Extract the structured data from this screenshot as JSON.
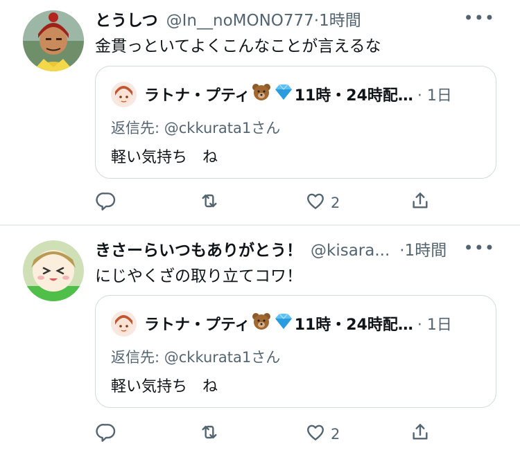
{
  "tweets": [
    {
      "name": "とうしつ",
      "handle": "@In__noMONO777",
      "time": "·1時間",
      "text": "金貫っといてよくこんなことが言えるな",
      "more": "•••",
      "quote": {
        "name": "ラトナ・プティ",
        "name_suffix": "11時・24時配…",
        "time": "· 1日",
        "reply_to": "返信先: @ckkurata1さん",
        "text": "軽い気持ち　ね"
      },
      "actions": {
        "reply": "",
        "retweet": "",
        "like_count": "2",
        "share": ""
      }
    },
    {
      "name": "きさーらいつもありがとう！",
      "handle": "@kisara...",
      "time": "·1時間",
      "text": "にじやくざの取り立てコワ！",
      "more": "•••",
      "quote": {
        "name": "ラトナ・プティ",
        "name_suffix": "11時・24時配…",
        "time": "· 1日",
        "reply_to": "返信先: @ckkurata1さん",
        "text": "軽い気持ち　ね"
      },
      "actions": {
        "reply": "",
        "retweet": "",
        "like_count": "2",
        "share": ""
      }
    }
  ],
  "colors": {
    "text": "#0f1419",
    "secondary": "#536471",
    "border": "#cfd9de",
    "divider": "#e6ecf0"
  },
  "icons": [
    "reply-icon",
    "retweet-icon",
    "like-icon",
    "share-icon",
    "more-icon",
    "bear-emoji-icon",
    "gem-emoji-icon"
  ]
}
